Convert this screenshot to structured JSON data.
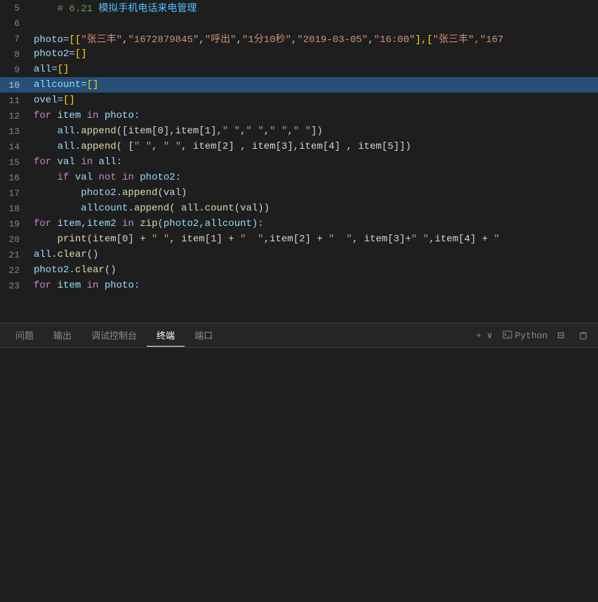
{
  "editor": {
    "lines": [
      {
        "num": 5,
        "highlighted": false,
        "tokens": [
          {
            "t": "    ",
            "cls": ""
          },
          {
            "t": "# 6.21 ",
            "cls": "kw-comment"
          },
          {
            "t": "模拟手机电话来电管理",
            "cls": "kw-chinese"
          }
        ]
      },
      {
        "num": 6,
        "highlighted": false,
        "tokens": []
      },
      {
        "num": 7,
        "highlighted": false,
        "tokens": [
          {
            "t": "photo=",
            "cls": "kw-var"
          },
          {
            "t": "[[",
            "cls": "kw-bracket"
          },
          {
            "t": "\"张三丰\"",
            "cls": "kw-string"
          },
          {
            "t": ",",
            "cls": ""
          },
          {
            "t": "\"1672879845\"",
            "cls": "kw-string"
          },
          {
            "t": ",",
            "cls": ""
          },
          {
            "t": "\"呼出\"",
            "cls": "kw-string"
          },
          {
            "t": ",",
            "cls": ""
          },
          {
            "t": "\"1分10秒\"",
            "cls": "kw-string"
          },
          {
            "t": ",",
            "cls": ""
          },
          {
            "t": "\"2019-03-05\"",
            "cls": "kw-string"
          },
          {
            "t": ",",
            "cls": ""
          },
          {
            "t": "\"16:00\"",
            "cls": "kw-string"
          },
          {
            "t": "]",
            "cls": "kw-bracket"
          },
          {
            "t": ",[",
            "cls": "kw-bracket"
          },
          {
            "t": "\"张三丰\"",
            "cls": "kw-string"
          },
          {
            "t": ",\"167",
            "cls": "kw-string"
          }
        ]
      },
      {
        "num": 8,
        "highlighted": false,
        "tokens": [
          {
            "t": "photo2=",
            "cls": "kw-var"
          },
          {
            "t": "[]",
            "cls": "kw-bracket"
          }
        ]
      },
      {
        "num": 9,
        "highlighted": false,
        "tokens": [
          {
            "t": "all=",
            "cls": "kw-var"
          },
          {
            "t": "[]",
            "cls": "kw-bracket"
          }
        ]
      },
      {
        "num": 10,
        "highlighted": true,
        "tokens": [
          {
            "t": "allcount=",
            "cls": "kw-var"
          },
          {
            "t": "[]",
            "cls": "kw-bracket"
          }
        ]
      },
      {
        "num": 11,
        "highlighted": false,
        "tokens": [
          {
            "t": "ovel=",
            "cls": "kw-var"
          },
          {
            "t": "[]",
            "cls": "kw-bracket"
          }
        ]
      },
      {
        "num": 12,
        "highlighted": false,
        "tokens": [
          {
            "t": "for",
            "cls": "kw-keyword"
          },
          {
            "t": " item ",
            "cls": "kw-var"
          },
          {
            "t": "in",
            "cls": "kw-keyword"
          },
          {
            "t": " photo:",
            "cls": "kw-var"
          }
        ]
      },
      {
        "num": 13,
        "highlighted": false,
        "tokens": [
          {
            "t": "    all.",
            "cls": "kw-var"
          },
          {
            "t": "append",
            "cls": "kw-func"
          },
          {
            "t": "([item[0],item[1],",
            "cls": ""
          },
          {
            "t": "\" \"",
            "cls": "kw-string"
          },
          {
            "t": ",",
            "cls": ""
          },
          {
            "t": "\" \"",
            "cls": "kw-string"
          },
          {
            "t": ",",
            "cls": ""
          },
          {
            "t": "\" \"",
            "cls": "kw-string"
          },
          {
            "t": ",",
            "cls": ""
          },
          {
            "t": "\" \"",
            "cls": "kw-string"
          },
          {
            "t": "])",
            "cls": ""
          }
        ]
      },
      {
        "num": 14,
        "highlighted": false,
        "tokens": [
          {
            "t": "    all.",
            "cls": "kw-var"
          },
          {
            "t": "append",
            "cls": "kw-func"
          },
          {
            "t": "( [",
            "cls": ""
          },
          {
            "t": "\" \"",
            "cls": "kw-string"
          },
          {
            "t": ", ",
            "cls": ""
          },
          {
            "t": "\" \"",
            "cls": "kw-string"
          },
          {
            "t": ", item[2] , item[3],item[4] , item[5]])",
            "cls": ""
          }
        ]
      },
      {
        "num": 15,
        "highlighted": false,
        "tokens": [
          {
            "t": "for",
            "cls": "kw-keyword"
          },
          {
            "t": " val ",
            "cls": "kw-var"
          },
          {
            "t": "in",
            "cls": "kw-keyword"
          },
          {
            "t": " all:",
            "cls": "kw-var"
          }
        ]
      },
      {
        "num": 16,
        "highlighted": false,
        "tokens": [
          {
            "t": "    ",
            "cls": ""
          },
          {
            "t": "if",
            "cls": "kw-keyword"
          },
          {
            "t": " val ",
            "cls": "kw-var"
          },
          {
            "t": "not",
            "cls": "kw-keyword"
          },
          {
            "t": " ",
            "cls": ""
          },
          {
            "t": "in",
            "cls": "kw-keyword"
          },
          {
            "t": " photo2:",
            "cls": "kw-var"
          }
        ]
      },
      {
        "num": 17,
        "highlighted": false,
        "tokens": [
          {
            "t": "        photo2.",
            "cls": "kw-var"
          },
          {
            "t": "append",
            "cls": "kw-func"
          },
          {
            "t": "(val)",
            "cls": ""
          }
        ]
      },
      {
        "num": 18,
        "highlighted": false,
        "tokens": [
          {
            "t": "        allcount.",
            "cls": "kw-var"
          },
          {
            "t": "append",
            "cls": "kw-func"
          },
          {
            "t": "( all.",
            "cls": ""
          },
          {
            "t": "count",
            "cls": "kw-func"
          },
          {
            "t": "(val))",
            "cls": ""
          }
        ]
      },
      {
        "num": 19,
        "highlighted": false,
        "tokens": [
          {
            "t": "for",
            "cls": "kw-keyword"
          },
          {
            "t": " item,item2 ",
            "cls": "kw-var"
          },
          {
            "t": "in",
            "cls": "kw-keyword"
          },
          {
            "t": " ",
            "cls": ""
          },
          {
            "t": "zip",
            "cls": "kw-func"
          },
          {
            "t": "(photo2,allcount):",
            "cls": "kw-var"
          }
        ]
      },
      {
        "num": 20,
        "highlighted": false,
        "tokens": [
          {
            "t": "    ",
            "cls": ""
          },
          {
            "t": "print",
            "cls": "kw-func"
          },
          {
            "t": "(item[0] + ",
            "cls": ""
          },
          {
            "t": "\" \"",
            "cls": "kw-string"
          },
          {
            "t": ", item[1] + ",
            "cls": ""
          },
          {
            "t": "\"  \"",
            "cls": "kw-string"
          },
          {
            "t": ",item[2] + ",
            "cls": ""
          },
          {
            "t": "\"  \"",
            "cls": "kw-string"
          },
          {
            "t": ", item[3]+",
            "cls": ""
          },
          {
            "t": "\" \"",
            "cls": "kw-string"
          },
          {
            "t": ",item[4] + ",
            "cls": ""
          },
          {
            "t": "\"",
            "cls": "kw-string"
          }
        ]
      },
      {
        "num": 21,
        "highlighted": false,
        "tokens": [
          {
            "t": "all.",
            "cls": "kw-var"
          },
          {
            "t": "clear",
            "cls": "kw-func"
          },
          {
            "t": "()",
            "cls": ""
          }
        ]
      },
      {
        "num": 22,
        "highlighted": false,
        "tokens": [
          {
            "t": "photo2.",
            "cls": "kw-var"
          },
          {
            "t": "clear",
            "cls": "kw-func"
          },
          {
            "t": "()",
            "cls": ""
          }
        ]
      },
      {
        "num": 23,
        "highlighted": false,
        "tokens": [
          {
            "t": "for",
            "cls": "kw-keyword"
          },
          {
            "t": " item ",
            "cls": "kw-var"
          },
          {
            "t": "in",
            "cls": "kw-keyword"
          },
          {
            "t": " photo:",
            "cls": "kw-var"
          }
        ]
      }
    ]
  },
  "panel": {
    "tabs": [
      {
        "label": "问题",
        "active": false
      },
      {
        "label": "输出",
        "active": false
      },
      {
        "label": "调试控制台",
        "active": false
      },
      {
        "label": "终端",
        "active": true
      },
      {
        "label": "端口",
        "active": false
      }
    ],
    "right_controls": [
      {
        "label": "+ ∨",
        "name": "new-terminal-btn"
      },
      {
        "label": "Python",
        "name": "python-label"
      },
      {
        "label": "⊟",
        "name": "split-terminal-btn"
      },
      {
        "label": "🗑",
        "name": "kill-terminal-btn"
      }
    ]
  }
}
